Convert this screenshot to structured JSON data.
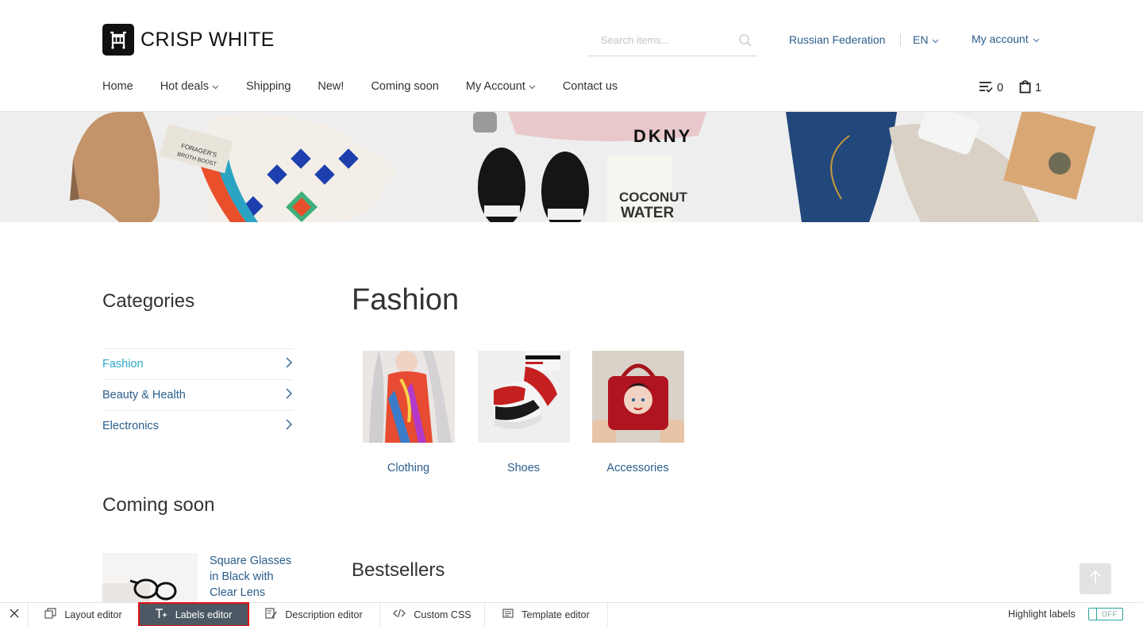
{
  "brand": {
    "name": "CRISP WHITE"
  },
  "search": {
    "placeholder": "Search items..."
  },
  "header": {
    "country": "Russian Federation",
    "language": "EN",
    "account": "My account"
  },
  "nav": {
    "items": [
      {
        "label": "Home",
        "has_dropdown": false
      },
      {
        "label": "Hot deals",
        "has_dropdown": true
      },
      {
        "label": "Shipping",
        "has_dropdown": false
      },
      {
        "label": "New!",
        "has_dropdown": false
      },
      {
        "label": "Coming soon",
        "has_dropdown": false
      },
      {
        "label": "My Account",
        "has_dropdown": true
      },
      {
        "label": "Contact us",
        "has_dropdown": false
      }
    ],
    "compare_count": "0",
    "cart_count": "1"
  },
  "banner": {
    "product_texts": [
      "FORAGER'S",
      "BROTH BOOST",
      "DKNY",
      "COCONUT",
      "WATER"
    ]
  },
  "sidebar": {
    "categories_title": "Categories",
    "categories": [
      {
        "label": "Fashion",
        "active": true
      },
      {
        "label": "Beauty & Health",
        "active": false
      },
      {
        "label": "Electronics",
        "active": false
      }
    ],
    "coming_soon_title": "Coming soon",
    "coming_soon_item": "Square Glasses in Black with Clear Lens"
  },
  "main": {
    "title": "Fashion",
    "subcategories": [
      {
        "label": "Clothing"
      },
      {
        "label": "Shoes"
      },
      {
        "label": "Accessories"
      }
    ],
    "bestsellers_title": "Bestsellers"
  },
  "toolbar": {
    "buttons": [
      {
        "label": "Layout editor",
        "active": false
      },
      {
        "label": "Labels editor",
        "active": true
      },
      {
        "label": "Description editor",
        "active": false
      },
      {
        "label": "Custom CSS",
        "active": false
      },
      {
        "label": "Template editor",
        "active": false
      }
    ],
    "highlight_label": "Highlight labels",
    "toggle_state": "OFF"
  },
  "colors": {
    "link": "#2a5e8c",
    "active_category": "#2aa7c9",
    "toolbar_active_bg": "#4c5863",
    "toolbar_active_outline": "#e01313",
    "toggle": "#2aa79b"
  }
}
